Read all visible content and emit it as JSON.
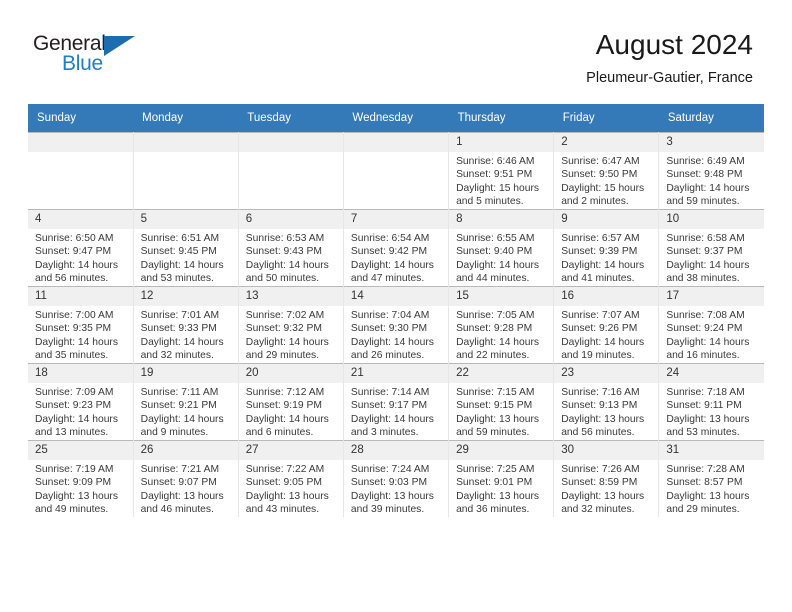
{
  "brand": {
    "name_part1": "General",
    "name_part2": "Blue",
    "logo_icon": "triangle-flag-icon"
  },
  "header": {
    "month_title": "August 2024",
    "location": "Pleumeur-Gautier, France"
  },
  "theme": {
    "header_blue": "#3479b8",
    "brand_blue": "#1f7ec4",
    "daynum_band": "#f0f0f0",
    "grid_line": "#b9b9b9"
  },
  "weekday_headers": [
    "Sunday",
    "Monday",
    "Tuesday",
    "Wednesday",
    "Thursday",
    "Friday",
    "Saturday"
  ],
  "labels": {
    "sunrise": "Sunrise:",
    "sunset": "Sunset:",
    "daylight": "Daylight:"
  },
  "weeks": [
    [
      {
        "day": "",
        "empty": true
      },
      {
        "day": "",
        "empty": true
      },
      {
        "day": "",
        "empty": true
      },
      {
        "day": "",
        "empty": true
      },
      {
        "day": "1",
        "sunrise": "Sunrise: 6:46 AM",
        "sunset": "Sunset: 9:51 PM",
        "daylight": "Daylight: 15 hours and 5 minutes."
      },
      {
        "day": "2",
        "sunrise": "Sunrise: 6:47 AM",
        "sunset": "Sunset: 9:50 PM",
        "daylight": "Daylight: 15 hours and 2 minutes."
      },
      {
        "day": "3",
        "sunrise": "Sunrise: 6:49 AM",
        "sunset": "Sunset: 9:48 PM",
        "daylight": "Daylight: 14 hours and 59 minutes."
      }
    ],
    [
      {
        "day": "4",
        "sunrise": "Sunrise: 6:50 AM",
        "sunset": "Sunset: 9:47 PM",
        "daylight": "Daylight: 14 hours and 56 minutes."
      },
      {
        "day": "5",
        "sunrise": "Sunrise: 6:51 AM",
        "sunset": "Sunset: 9:45 PM",
        "daylight": "Daylight: 14 hours and 53 minutes."
      },
      {
        "day": "6",
        "sunrise": "Sunrise: 6:53 AM",
        "sunset": "Sunset: 9:43 PM",
        "daylight": "Daylight: 14 hours and 50 minutes."
      },
      {
        "day": "7",
        "sunrise": "Sunrise: 6:54 AM",
        "sunset": "Sunset: 9:42 PM",
        "daylight": "Daylight: 14 hours and 47 minutes."
      },
      {
        "day": "8",
        "sunrise": "Sunrise: 6:55 AM",
        "sunset": "Sunset: 9:40 PM",
        "daylight": "Daylight: 14 hours and 44 minutes."
      },
      {
        "day": "9",
        "sunrise": "Sunrise: 6:57 AM",
        "sunset": "Sunset: 9:39 PM",
        "daylight": "Daylight: 14 hours and 41 minutes."
      },
      {
        "day": "10",
        "sunrise": "Sunrise: 6:58 AM",
        "sunset": "Sunset: 9:37 PM",
        "daylight": "Daylight: 14 hours and 38 minutes."
      }
    ],
    [
      {
        "day": "11",
        "sunrise": "Sunrise: 7:00 AM",
        "sunset": "Sunset: 9:35 PM",
        "daylight": "Daylight: 14 hours and 35 minutes."
      },
      {
        "day": "12",
        "sunrise": "Sunrise: 7:01 AM",
        "sunset": "Sunset: 9:33 PM",
        "daylight": "Daylight: 14 hours and 32 minutes."
      },
      {
        "day": "13",
        "sunrise": "Sunrise: 7:02 AM",
        "sunset": "Sunset: 9:32 PM",
        "daylight": "Daylight: 14 hours and 29 minutes."
      },
      {
        "day": "14",
        "sunrise": "Sunrise: 7:04 AM",
        "sunset": "Sunset: 9:30 PM",
        "daylight": "Daylight: 14 hours and 26 minutes."
      },
      {
        "day": "15",
        "sunrise": "Sunrise: 7:05 AM",
        "sunset": "Sunset: 9:28 PM",
        "daylight": "Daylight: 14 hours and 22 minutes."
      },
      {
        "day": "16",
        "sunrise": "Sunrise: 7:07 AM",
        "sunset": "Sunset: 9:26 PM",
        "daylight": "Daylight: 14 hours and 19 minutes."
      },
      {
        "day": "17",
        "sunrise": "Sunrise: 7:08 AM",
        "sunset": "Sunset: 9:24 PM",
        "daylight": "Daylight: 14 hours and 16 minutes."
      }
    ],
    [
      {
        "day": "18",
        "sunrise": "Sunrise: 7:09 AM",
        "sunset": "Sunset: 9:23 PM",
        "daylight": "Daylight: 14 hours and 13 minutes."
      },
      {
        "day": "19",
        "sunrise": "Sunrise: 7:11 AM",
        "sunset": "Sunset: 9:21 PM",
        "daylight": "Daylight: 14 hours and 9 minutes."
      },
      {
        "day": "20",
        "sunrise": "Sunrise: 7:12 AM",
        "sunset": "Sunset: 9:19 PM",
        "daylight": "Daylight: 14 hours and 6 minutes."
      },
      {
        "day": "21",
        "sunrise": "Sunrise: 7:14 AM",
        "sunset": "Sunset: 9:17 PM",
        "daylight": "Daylight: 14 hours and 3 minutes."
      },
      {
        "day": "22",
        "sunrise": "Sunrise: 7:15 AM",
        "sunset": "Sunset: 9:15 PM",
        "daylight": "Daylight: 13 hours and 59 minutes."
      },
      {
        "day": "23",
        "sunrise": "Sunrise: 7:16 AM",
        "sunset": "Sunset: 9:13 PM",
        "daylight": "Daylight: 13 hours and 56 minutes."
      },
      {
        "day": "24",
        "sunrise": "Sunrise: 7:18 AM",
        "sunset": "Sunset: 9:11 PM",
        "daylight": "Daylight: 13 hours and 53 minutes."
      }
    ],
    [
      {
        "day": "25",
        "sunrise": "Sunrise: 7:19 AM",
        "sunset": "Sunset: 9:09 PM",
        "daylight": "Daylight: 13 hours and 49 minutes."
      },
      {
        "day": "26",
        "sunrise": "Sunrise: 7:21 AM",
        "sunset": "Sunset: 9:07 PM",
        "daylight": "Daylight: 13 hours and 46 minutes."
      },
      {
        "day": "27",
        "sunrise": "Sunrise: 7:22 AM",
        "sunset": "Sunset: 9:05 PM",
        "daylight": "Daylight: 13 hours and 43 minutes."
      },
      {
        "day": "28",
        "sunrise": "Sunrise: 7:24 AM",
        "sunset": "Sunset: 9:03 PM",
        "daylight": "Daylight: 13 hours and 39 minutes."
      },
      {
        "day": "29",
        "sunrise": "Sunrise: 7:25 AM",
        "sunset": "Sunset: 9:01 PM",
        "daylight": "Daylight: 13 hours and 36 minutes."
      },
      {
        "day": "30",
        "sunrise": "Sunrise: 7:26 AM",
        "sunset": "Sunset: 8:59 PM",
        "daylight": "Daylight: 13 hours and 32 minutes."
      },
      {
        "day": "31",
        "sunrise": "Sunrise: 7:28 AM",
        "sunset": "Sunset: 8:57 PM",
        "daylight": "Daylight: 13 hours and 29 minutes."
      }
    ]
  ]
}
